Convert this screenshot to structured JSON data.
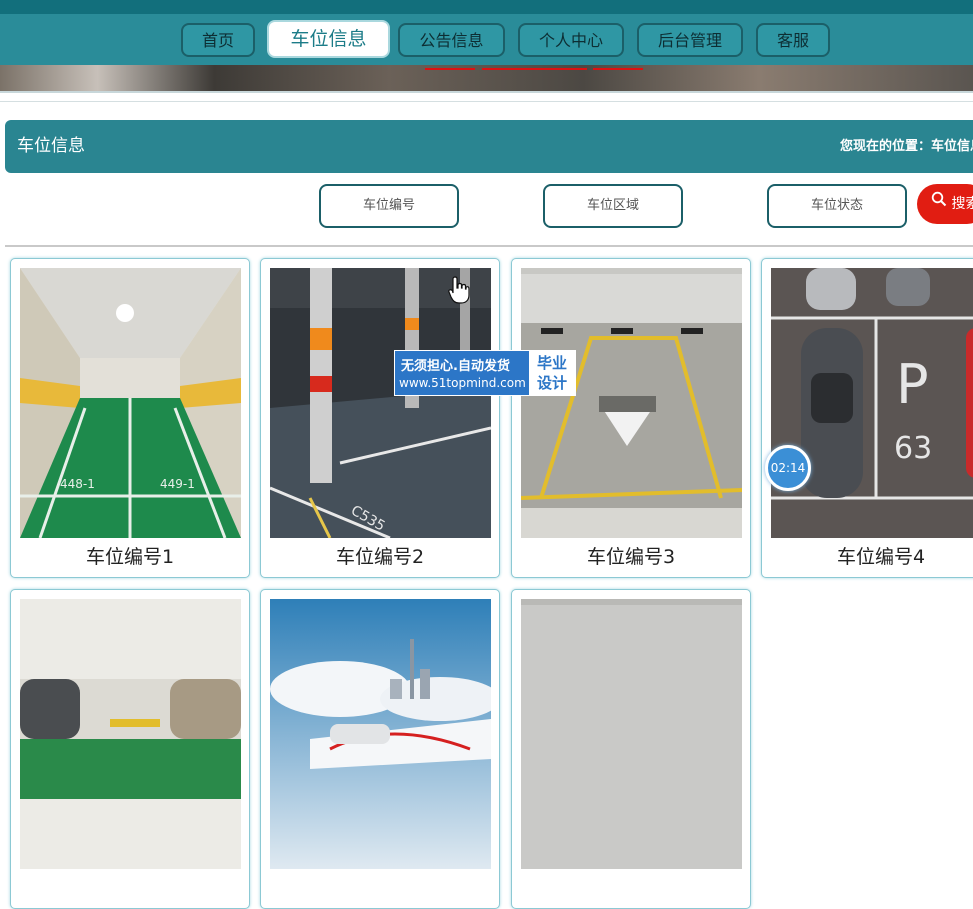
{
  "nav": {
    "items": [
      {
        "label": "首页"
      },
      {
        "label": "车位信息"
      },
      {
        "label": "公告信息"
      },
      {
        "label": "个人中心"
      },
      {
        "label": "后台管理"
      },
      {
        "label": "客服"
      }
    ],
    "active_index": 1
  },
  "section": {
    "title": "车位信息",
    "breadcrumb": "您现在的位置：车位信息"
  },
  "filters": {
    "fields": [
      {
        "placeholder": "车位编号"
      },
      {
        "placeholder": "车位区域"
      },
      {
        "placeholder": "车位状态"
      }
    ],
    "search_label": "搜索",
    "search_icon": "search-icon"
  },
  "cards": [
    {
      "label": "车位编号1"
    },
    {
      "label": "车位编号2"
    },
    {
      "label": "车位编号3"
    },
    {
      "label": "车位编号4"
    },
    {
      "label": ""
    },
    {
      "label": ""
    },
    {
      "label": ""
    }
  ],
  "watermark": {
    "line1": "无须担心.自动发货",
    "line2": "www.51topmind.com",
    "badge1": "毕业",
    "badge2": "设计"
  },
  "timer": {
    "text": "02:14"
  },
  "colors": {
    "primary": "#2a8591",
    "dark": "#126f7c",
    "search": "#e11d12"
  }
}
